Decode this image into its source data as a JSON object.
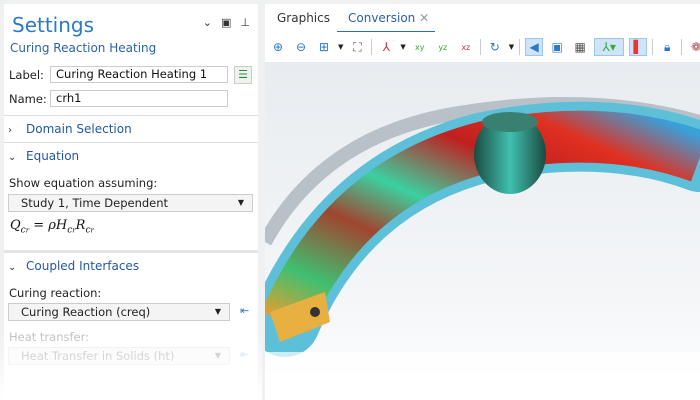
{
  "settings": {
    "title": "Settings",
    "subtitle": "Curing Reaction Heating",
    "label_label": "Label:",
    "label_value": "Curing Reaction Heating 1",
    "name_label": "Name:",
    "name_value": "crh1"
  },
  "sections": {
    "domain_selection": "Domain Selection",
    "equation": "Equation",
    "coupled_interfaces": "Coupled Interfaces"
  },
  "equation": {
    "show_label": "Show equation assuming:",
    "study_value": "Study 1, Time Dependent",
    "formula_lhs": "Q",
    "formula_rhs": "= ρH",
    "sub": "c",
    "subsub": "r",
    "r": "R"
  },
  "coupled": {
    "curing_label": "Curing reaction:",
    "curing_value": "Curing Reaction (creq)",
    "heat_label": "Heat transfer:",
    "heat_value": "Heat Transfer in Solids (ht)"
  },
  "tabs": [
    {
      "label": "Graphics"
    },
    {
      "label": "Conversion"
    }
  ]
}
